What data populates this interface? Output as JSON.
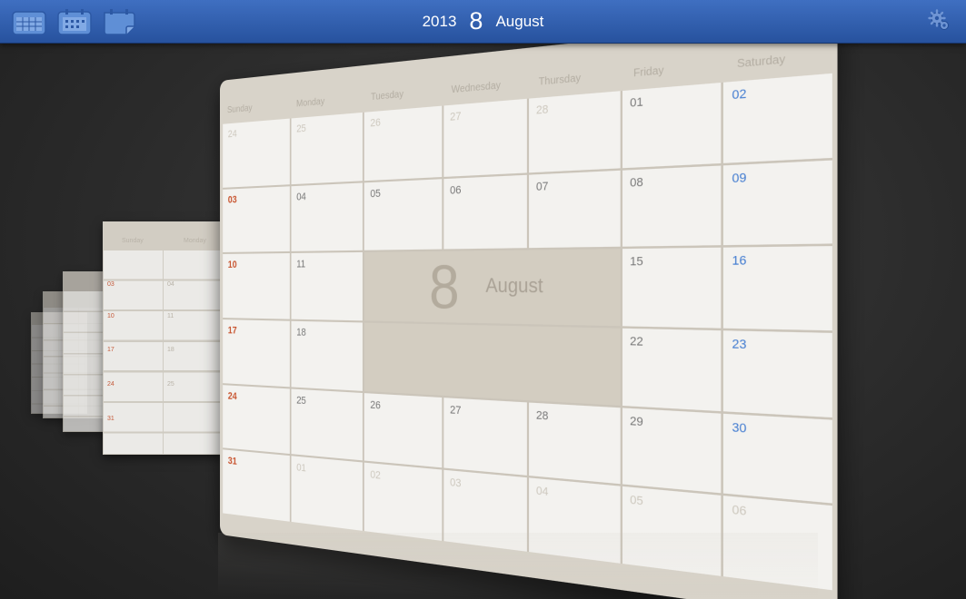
{
  "toolbar": {
    "year": "2013",
    "day": "8",
    "month": "August"
  },
  "calendar": {
    "days_of_week": [
      "Sunday",
      "Monday",
      "Tuesday",
      "Wednesday",
      "Thursday",
      "Friday",
      "Saturday"
    ],
    "weeks": [
      [
        "24",
        "25",
        "26",
        "27",
        "28",
        "01",
        "02"
      ],
      [
        "03",
        "04",
        "05",
        "06",
        "07",
        "08",
        "09"
      ],
      [
        "10",
        "11",
        "",
        "",
        "",
        "15",
        "16"
      ],
      [
        "17",
        "18",
        "",
        "",
        "",
        "22",
        "23"
      ],
      [
        "24",
        "25",
        "26",
        "27",
        "28",
        "29",
        "30"
      ],
      [
        "31",
        "01",
        "02",
        "03",
        "04",
        "05",
        "06"
      ]
    ],
    "today": {
      "day": "8",
      "month": "August"
    }
  },
  "ghost_preview": {
    "header": [
      "Sunday",
      "Monday"
    ],
    "dates": [
      "03",
      "04",
      "10",
      "11",
      "17",
      "18",
      "24",
      "25",
      "31"
    ]
  },
  "colors": {
    "toolbar_blue": "#3f6fc1",
    "sunday": "#c8542f",
    "saturday": "#3f7ad0",
    "card": "#d8d3c9"
  }
}
